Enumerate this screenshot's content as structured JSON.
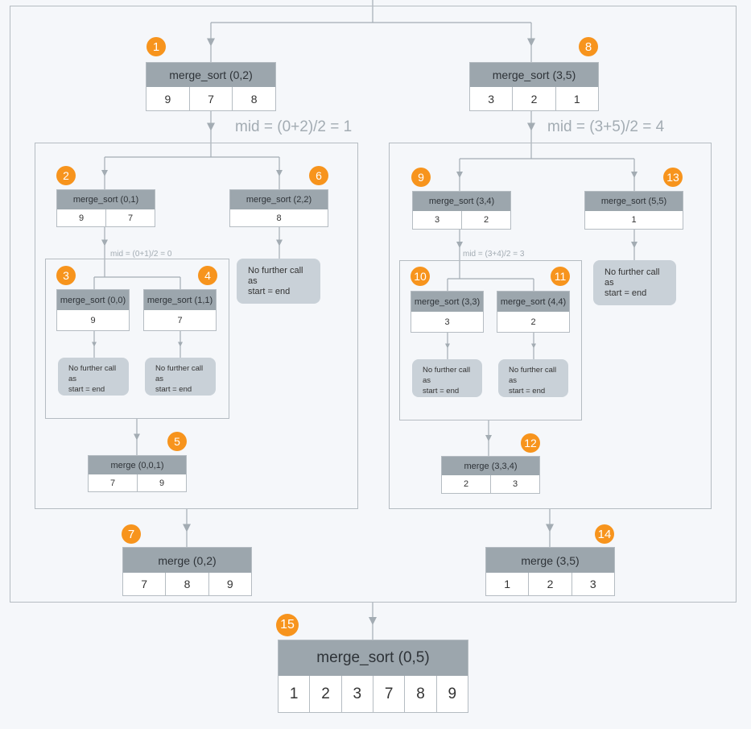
{
  "colors": {
    "badge": "#f7941d",
    "header": "#9ca6ad",
    "note": "#c9d1d8",
    "line": "#a3acb3",
    "background": "#f5f7fa"
  },
  "nodes": [
    {
      "step": "1",
      "label": "merge_sort (0,2)",
      "values": [
        "9",
        "7",
        "8"
      ]
    },
    {
      "step": "2",
      "label": "merge_sort (0,1)",
      "values": [
        "9",
        "7"
      ]
    },
    {
      "step": "3",
      "label": "merge_sort (0,0)",
      "values": [
        "9"
      ]
    },
    {
      "step": "4",
      "label": "merge_sort (1,1)",
      "values": [
        "7"
      ]
    },
    {
      "step": "5",
      "label": "merge (0,0,1)",
      "values": [
        "7",
        "9"
      ]
    },
    {
      "step": "6",
      "label": "merge_sort (2,2)",
      "values": [
        "8"
      ]
    },
    {
      "step": "7",
      "label": "merge (0,2)",
      "values": [
        "7",
        "8",
        "9"
      ]
    },
    {
      "step": "8",
      "label": "merge_sort (3,5)",
      "values": [
        "3",
        "2",
        "1"
      ]
    },
    {
      "step": "9",
      "label": "merge_sort (3,4)",
      "values": [
        "3",
        "2"
      ]
    },
    {
      "step": "10",
      "label": "merge_sort (3,3)",
      "values": [
        "3"
      ]
    },
    {
      "step": "11",
      "label": "merge_sort (4,4)",
      "values": [
        "2"
      ]
    },
    {
      "step": "12",
      "label": "merge (3,3,4)",
      "values": [
        "2",
        "3"
      ]
    },
    {
      "step": "13",
      "label": "merge_sort (5,5)",
      "values": [
        "1"
      ]
    },
    {
      "step": "14",
      "label": "merge (3,5)",
      "values": [
        "1",
        "2",
        "3"
      ]
    },
    {
      "step": "15",
      "label": "merge_sort (0,5)",
      "values": [
        "1",
        "2",
        "3",
        "7",
        "8",
        "9"
      ]
    }
  ],
  "mids": [
    "mid = (0+2)/2 = 1",
    "mid = (3+5)/2 = 4",
    "mid = (0+1)/2 = 0",
    "mid = (3+4)/2 = 3"
  ],
  "note": {
    "line1": "No further call",
    "line2": "as",
    "line3": "start = end"
  }
}
